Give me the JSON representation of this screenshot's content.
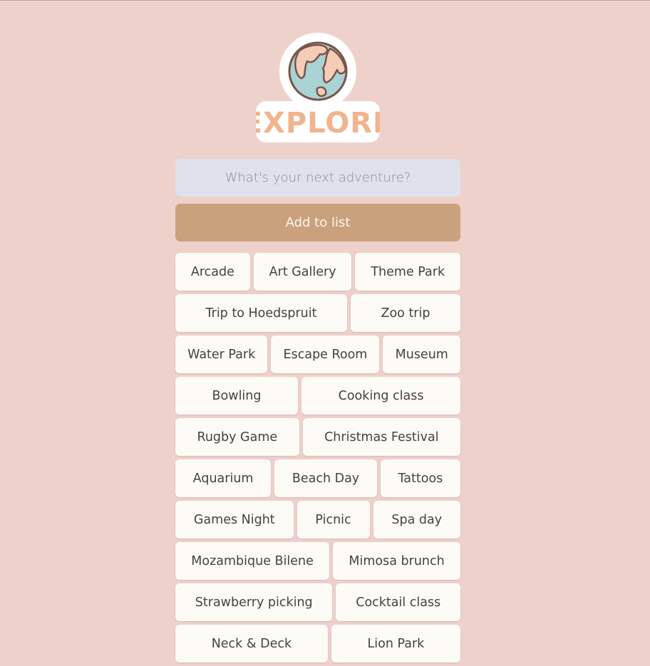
{
  "logo": {
    "icon": "globe-icon",
    "text": "EXPLORE",
    "colors": {
      "text": "#f0b48f",
      "ocean": "#a9d3d4",
      "land": "#f5ccb6",
      "outline": "#7a544a"
    }
  },
  "input": {
    "placeholder": "What's your next adventure?",
    "value": ""
  },
  "add_button": {
    "label": "Add to list"
  },
  "items": [
    [
      "Arcade",
      "Art Gallery",
      "Theme Park"
    ],
    [
      "Trip to Hoedspruit",
      "Zoo trip"
    ],
    [
      "Water Park",
      "Escape Room",
      "Museum"
    ],
    [
      "Bowling",
      "Cooking class"
    ],
    [
      "Rugby Game",
      "Christmas Festival"
    ],
    [
      "Aquarium",
      "Beach Day",
      "Tattoos"
    ],
    [
      "Games Night",
      "Picnic",
      "Spa day"
    ],
    [
      "Mozambique Bilene",
      "Mimosa brunch"
    ],
    [
      "Strawberry picking",
      "Cocktail class"
    ],
    [
      "Neck & Deck",
      "Lion Park"
    ]
  ],
  "colors": {
    "background": "#efd1cc",
    "input_bg": "#dfe1ec",
    "button_bg": "#caa17d",
    "item_bg": "#fdfbf5",
    "item_text": "#4a3f3b"
  }
}
